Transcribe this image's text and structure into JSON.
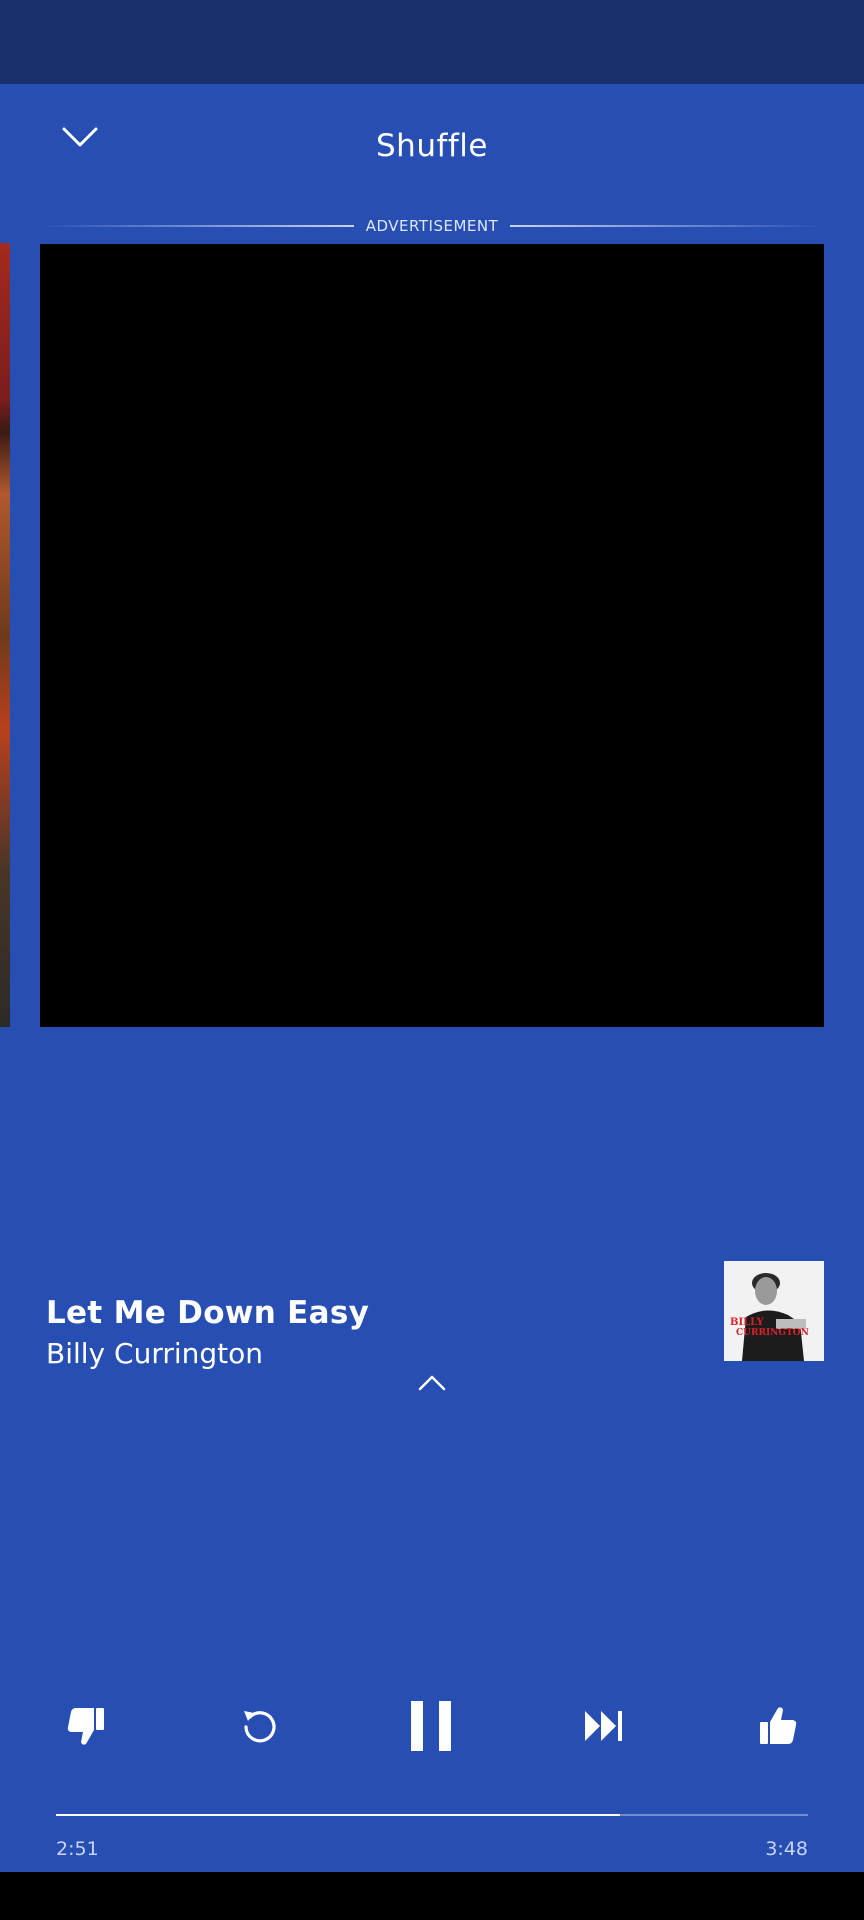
{
  "header": {
    "title": "Shuffle",
    "collapse_icon": "chevron-down-icon"
  },
  "ad": {
    "label": "ADVERTISEMENT"
  },
  "track": {
    "title": "Let Me Down Easy",
    "artist": "Billy Currington",
    "album_art_text": "BILLY CURRINGTON"
  },
  "expand_icon": "chevron-up-icon",
  "controls": [
    {
      "name": "thumbs-down-icon"
    },
    {
      "name": "replay-icon"
    },
    {
      "name": "pause-icon"
    },
    {
      "name": "skip-next-icon"
    },
    {
      "name": "thumbs-up-icon"
    }
  ],
  "progress": {
    "elapsed": "2:51",
    "total": "3:48",
    "fraction": 0.75
  },
  "colors": {
    "background": "#274fb3",
    "status_bar": "#192f6e",
    "ad_area": "#000000"
  }
}
